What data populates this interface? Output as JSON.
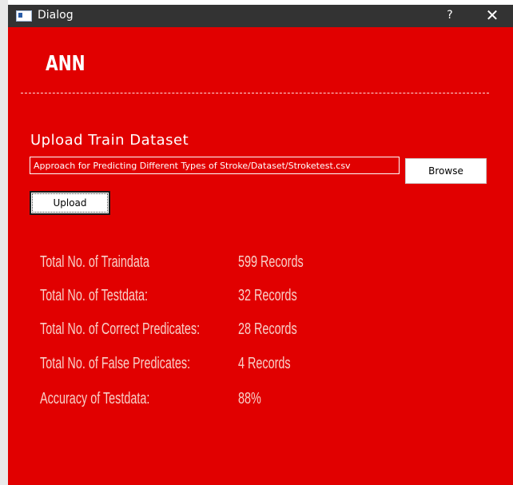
{
  "window": {
    "title": "Dialog",
    "help_label": "?",
    "close_label": "✕"
  },
  "main": {
    "heading": "ANN",
    "upload_label": "Upload Train Dataset",
    "path_value": "Approach for Predicting Different Types of Stroke/Dataset/Stroketest.csv",
    "browse_label": "Browse",
    "upload_button_label": "Upload"
  },
  "stats": [
    {
      "label": "Total No. of Traindata",
      "value": "599 Records"
    },
    {
      "label": "Total No. of Testdata:",
      "value": "32 Records"
    },
    {
      "label": "Total No. of Correct Predicates:",
      "value": "28 Records"
    },
    {
      "label": "Total No. of False Predicates:",
      "value": "4 Records"
    },
    {
      "label": "Accuracy of Testdata:",
      "value": "88%"
    }
  ],
  "colors": {
    "background": "#e10000",
    "titlebar": "#333333",
    "text": "#ffffff",
    "stat_text": "#f8d0c8"
  }
}
